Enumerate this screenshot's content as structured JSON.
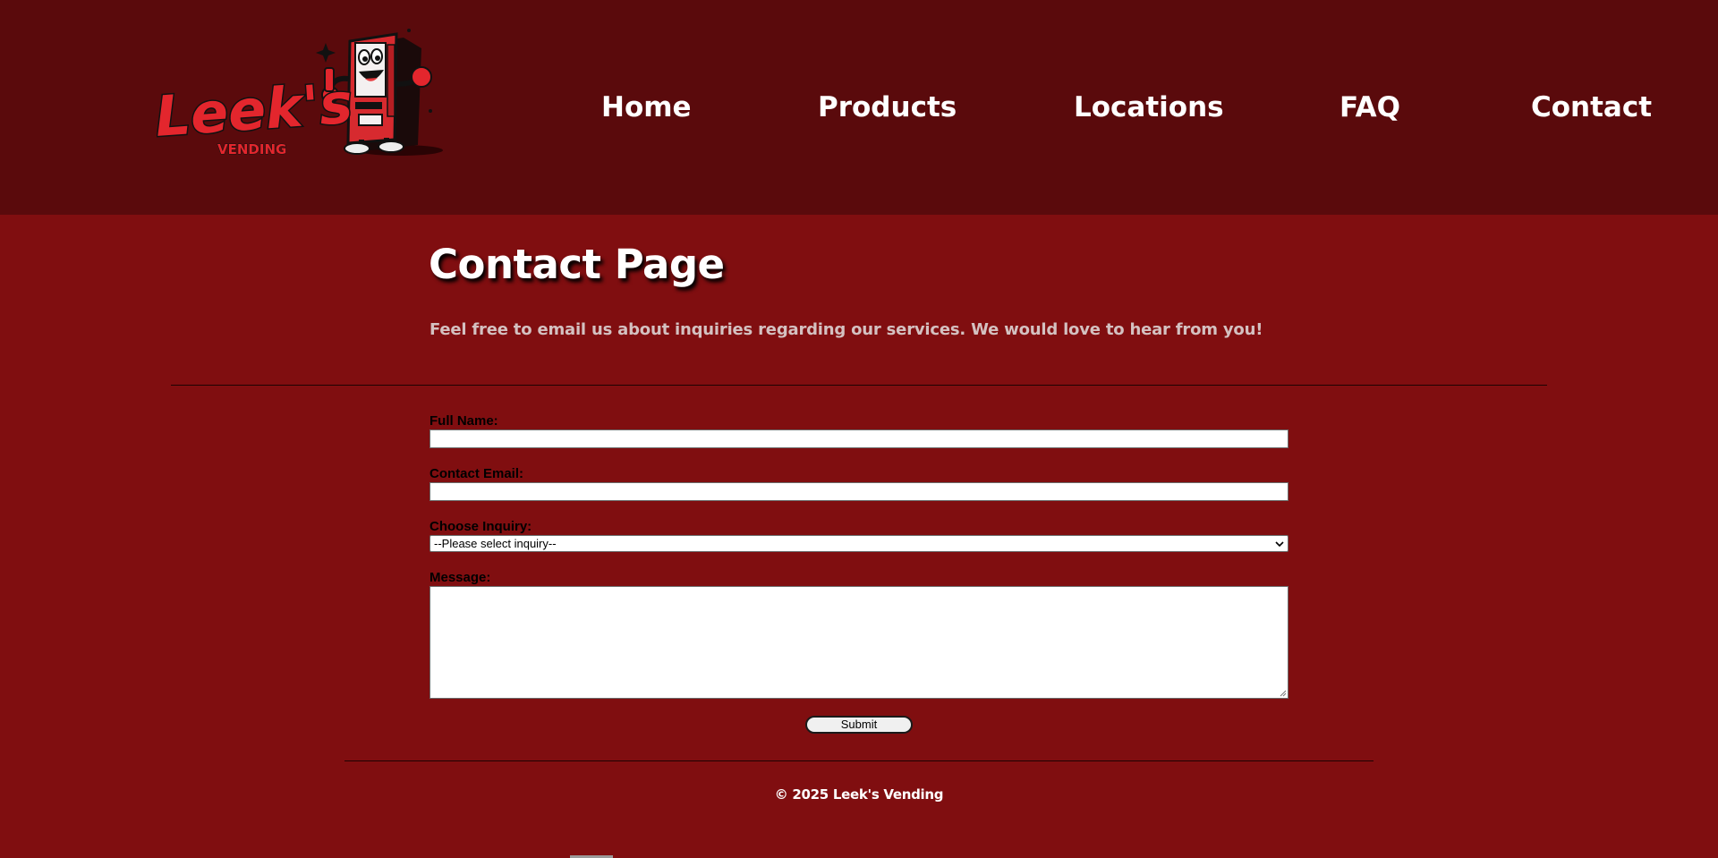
{
  "brand": {
    "logo_word": "Leek's",
    "logo_sub": "VENDING",
    "accent": "#e3262d",
    "header_bg": "#5a0a0c",
    "page_bg": "#800e10"
  },
  "nav": {
    "items": [
      {
        "label": "Home"
      },
      {
        "label": "Products"
      },
      {
        "label": "Locations"
      },
      {
        "label": "FAQ"
      },
      {
        "label": "Contact"
      }
    ]
  },
  "main": {
    "title": "Contact Page",
    "intro": "Feel free to email us about inquiries regarding our services. We would love to hear from you!"
  },
  "form": {
    "name_label": "Full Name:",
    "name_value": "",
    "email_label": "Contact Email:",
    "email_value": "",
    "inquiry_label": "Choose Inquiry:",
    "inquiry_selected": "--Please select inquiry--",
    "message_label": "Message:",
    "message_value": "",
    "submit_label": "Submit"
  },
  "footer": {
    "copyright": "© 2025 Leek's Vending"
  }
}
